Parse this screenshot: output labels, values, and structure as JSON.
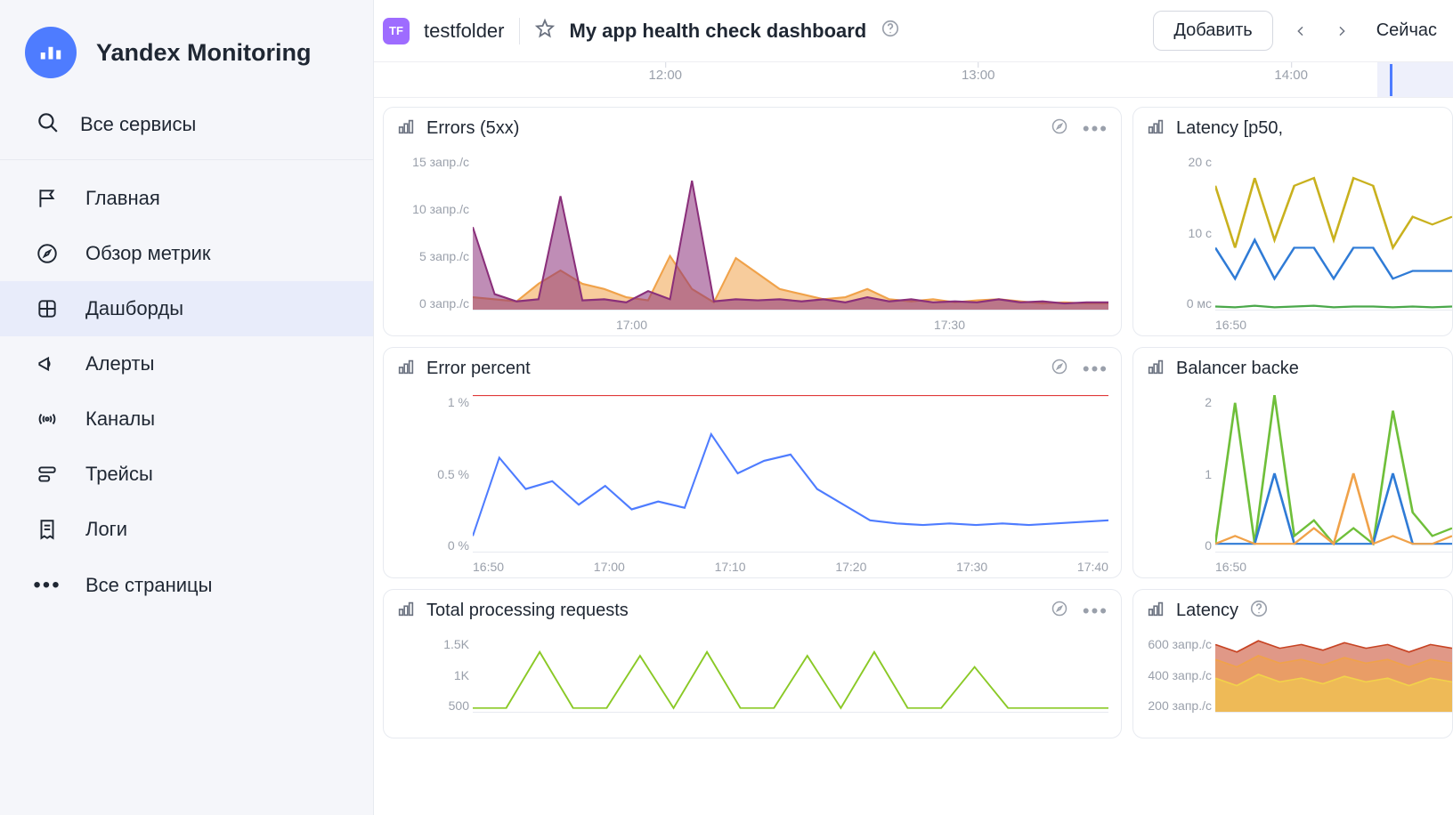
{
  "brand": {
    "title": "Yandex Monitoring"
  },
  "sidebar": {
    "search_label": "Все сервисы",
    "items": [
      {
        "label": "Главная"
      },
      {
        "label": "Обзор метрик"
      },
      {
        "label": "Дашборды"
      },
      {
        "label": "Алерты"
      },
      {
        "label": "Каналы"
      },
      {
        "label": "Трейсы"
      },
      {
        "label": "Логи"
      },
      {
        "label": "Все страницы"
      }
    ]
  },
  "header": {
    "folder_badge": "TF",
    "folder_name": "testfolder",
    "dashboard_title": "My app health check dashboard",
    "add_button": "Добавить",
    "now_label": "Сейчас"
  },
  "ruler": {
    "ticks": [
      "12:00",
      "13:00",
      "14:00"
    ]
  },
  "panels": {
    "errors": {
      "title": "Errors (5xx)",
      "ylabels": [
        "15 запр./с",
        "10 запр./с",
        "5 запр./с",
        "0 запр./с"
      ],
      "xlabels": [
        "17:00",
        "17:30"
      ]
    },
    "error_percent": {
      "title": "Error percent",
      "ylabels": [
        "1 %",
        "0.5 %",
        "0 %"
      ],
      "xlabels": [
        "16:50",
        "17:00",
        "17:10",
        "17:20",
        "17:30",
        "17:40"
      ]
    },
    "total_proc": {
      "title": "Total processing requests",
      "ylabels": [
        "1.5K",
        "1K",
        "500"
      ],
      "xlabels": []
    },
    "latency_p50": {
      "title": "Latency [p50,",
      "ylabels": [
        "20 с",
        "10 с",
        "0 мс"
      ],
      "xlabels": [
        "16:50"
      ]
    },
    "balancer": {
      "title": "Balancer backe",
      "ylabels": [
        "2",
        "1",
        "0"
      ],
      "xlabels": [
        "16:50"
      ]
    },
    "latency": {
      "title": "Latency",
      "ylabels": [
        "600 запр./с",
        "400 запр./с",
        "200 запр./с"
      ],
      "xlabels": []
    }
  },
  "chart_data": [
    {
      "id": "errors",
      "type": "area",
      "title": "Errors (5xx)",
      "ylabel": "запр./с",
      "ylim": [
        0,
        15
      ],
      "xlabels": [
        "17:00",
        "17:30"
      ],
      "series": [
        {
          "name": "orange",
          "color": "#f0a24a",
          "values": [
            1.2,
            1.0,
            0.8,
            2.5,
            3.8,
            2.5,
            2.0,
            1.2,
            0.9,
            5.2,
            2.0,
            0.7,
            5.0,
            3.5,
            2.0,
            1.5,
            1.0,
            1.2,
            2.0,
            1.0,
            0.8,
            1.0,
            0.7,
            0.9,
            1.0,
            0.8,
            0.6,
            0.7,
            0.6,
            0.6
          ]
        },
        {
          "name": "purple",
          "color": "#8a2f7a",
          "values": [
            8.0,
            1.5,
            0.8,
            1.0,
            11.0,
            0.9,
            1.0,
            0.7,
            1.8,
            1.0,
            12.5,
            0.8,
            1.0,
            0.9,
            1.0,
            0.8,
            1.0,
            0.7,
            1.2,
            0.8,
            1.0,
            0.7,
            0.8,
            0.7,
            1.0,
            0.7,
            0.8,
            0.6,
            0.7,
            0.7
          ]
        }
      ]
    },
    {
      "id": "error_percent",
      "type": "line",
      "title": "Error percent",
      "ylabel": "%",
      "ylim": [
        0,
        1
      ],
      "threshold": 1.0,
      "x": [
        "16:50",
        "17:00",
        "17:10",
        "17:20",
        "17:30",
        "17:40"
      ],
      "series": [
        {
          "name": "percent",
          "color": "#4e7cff",
          "values": [
            0.1,
            0.6,
            0.4,
            0.45,
            0.3,
            0.42,
            0.27,
            0.32,
            0.28,
            0.75,
            0.5,
            0.58,
            0.62,
            0.4,
            0.3,
            0.2,
            0.18,
            0.17,
            0.18,
            0.17,
            0.18,
            0.17,
            0.18,
            0.19,
            0.2
          ]
        }
      ]
    },
    {
      "id": "total_proc",
      "type": "line",
      "title": "Total processing requests",
      "ylabel": "",
      "ylim": [
        500,
        1500
      ],
      "series": [
        {
          "name": "green",
          "color": "#8ac926",
          "values": [
            550,
            550,
            1300,
            550,
            550,
            1250,
            550,
            1300,
            550,
            550,
            1250,
            550,
            1300,
            550,
            550,
            1100,
            550,
            550,
            550,
            550
          ]
        }
      ]
    },
    {
      "id": "latency_p50",
      "type": "line",
      "title": "Latency [p50,",
      "ylabel": "",
      "ylim": [
        0,
        20
      ],
      "xlabels": [
        "16:50"
      ],
      "series": [
        {
          "name": "yellow",
          "color": "#c9b11e",
          "values": [
            16,
            8,
            17,
            9,
            16,
            17,
            9,
            17,
            16,
            8,
            12,
            11,
            12
          ]
        },
        {
          "name": "blue",
          "color": "#2f7bd6",
          "values": [
            8,
            4,
            9,
            4,
            8,
            8,
            4,
            8,
            8,
            4,
            5,
            5,
            5
          ]
        },
        {
          "name": "green",
          "color": "#4aa84a",
          "values": [
            0.4,
            0.3,
            0.5,
            0.3,
            0.4,
            0.5,
            0.3,
            0.4,
            0.4,
            0.3,
            0.4,
            0.3,
            0.4
          ]
        }
      ]
    },
    {
      "id": "balancer",
      "type": "line",
      "title": "Balancer backe",
      "ylabel": "",
      "ylim": [
        0,
        2
      ],
      "xlabels": [
        "16:50"
      ],
      "series": [
        {
          "name": "green",
          "color": "#6fbf3a",
          "values": [
            0.1,
            1.9,
            0.1,
            2.0,
            0.2,
            0.4,
            0.1,
            0.3,
            0.1,
            1.8,
            0.5,
            0.2,
            0.3
          ]
        },
        {
          "name": "blue",
          "color": "#2f7bd6",
          "values": [
            0.1,
            0.1,
            0.1,
            1.0,
            0.1,
            0.1,
            0.1,
            0.1,
            0.1,
            1.0,
            0.1,
            0.1,
            0.1
          ]
        },
        {
          "name": "orange",
          "color": "#f0a24a",
          "values": [
            0.1,
            0.2,
            0.1,
            0.1,
            0.1,
            0.3,
            0.1,
            1.0,
            0.1,
            0.2,
            0.1,
            0.1,
            0.2
          ]
        }
      ]
    },
    {
      "id": "latency",
      "type": "area",
      "title": "Latency",
      "ylabel": "запр./с",
      "ylim": [
        200,
        600
      ],
      "series": [
        {
          "name": "red",
          "color": "#c74424",
          "values": [
            560,
            520,
            580,
            540,
            560,
            530,
            570,
            540,
            560,
            520,
            560,
            540
          ]
        },
        {
          "name": "orange",
          "color": "#f0a24a",
          "values": [
            480,
            440,
            500,
            460,
            480,
            450,
            490,
            460,
            480,
            440,
            480,
            460
          ]
        },
        {
          "name": "yellow",
          "color": "#f2d24a",
          "values": [
            380,
            340,
            400,
            360,
            380,
            350,
            390,
            360,
            380,
            340,
            380,
            360
          ]
        }
      ]
    }
  ]
}
